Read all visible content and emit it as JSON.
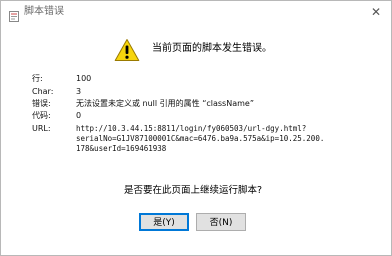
{
  "window": {
    "title": "脚本错误",
    "close_glyph": "✕"
  },
  "headline": "当前页面的脚本发生错误。",
  "details": {
    "line_label": "行:",
    "line_value": "100",
    "char_label": "Char:",
    "char_value": "3",
    "error_label": "错误:",
    "error_value": "无法设置未定义或 null 引用的属性 “className”",
    "code_label": "代码:",
    "code_value": "0",
    "url_label": "URL:",
    "url_lines": [
      "http://10.3.44.15:8811/login/fy060503/url-dgy.html?",
      "serialNo=G1JV87100001C&mac=6476.ba9a.575a&ip=10.25.200.",
      "178&userId=169461938"
    ]
  },
  "question": "是否要在此页面上继续运行脚本?",
  "buttons": {
    "yes_label": "是(Y)",
    "no_label": "否(N)"
  },
  "icons": {
    "title": "script-doc-icon",
    "warning": "warning-icon"
  },
  "colors": {
    "warning_fill": "#f7d50c",
    "primary_border": "#0078d7"
  }
}
